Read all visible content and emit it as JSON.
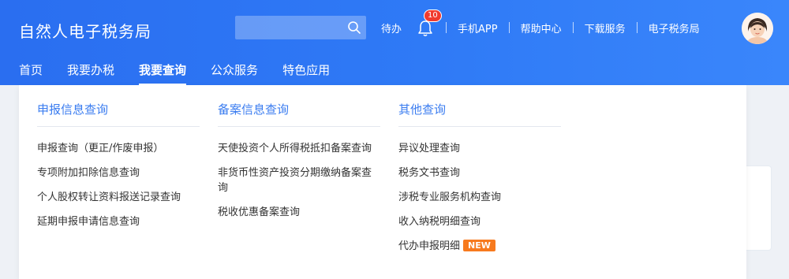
{
  "header": {
    "brand": "自然人电子税务局",
    "search_placeholder": "",
    "todo": "待办",
    "notification_count": "10",
    "links": [
      "手机APP",
      "帮助中心",
      "下载服务",
      "电子税务局"
    ]
  },
  "nav": {
    "tabs": [
      "首页",
      "我要办税",
      "我要查询",
      "公众服务",
      "特色应用"
    ],
    "active_index": 2
  },
  "menu": {
    "col1": {
      "title": "申报信息查询",
      "items": [
        "申报查询（更正/作废申报）",
        "专项附加扣除信息查询",
        "个人股权转让资料报送记录查询",
        "延期申报申请信息查询"
      ]
    },
    "col2": {
      "title": "备案信息查询",
      "items": [
        "天使投资个人所得税抵扣备案查询",
        "非货币性资产投资分期缴纳备案查询",
        "税收优惠备案查询"
      ]
    },
    "col3": {
      "title": "其他查询",
      "items": [
        "异议处理查询",
        "税务文书查询",
        "涉税专业服务机构查询",
        "收入纳税明细查询",
        "代办申报明细"
      ],
      "new_badge": "NEW"
    }
  },
  "colors": {
    "header_blue": "#2f7af6",
    "title_blue": "#3a7cf0",
    "badge_red": "#f03b2e",
    "new_orange": "#f77a1e"
  },
  "icons": [
    "search-icon",
    "bell-icon",
    "avatar"
  ]
}
